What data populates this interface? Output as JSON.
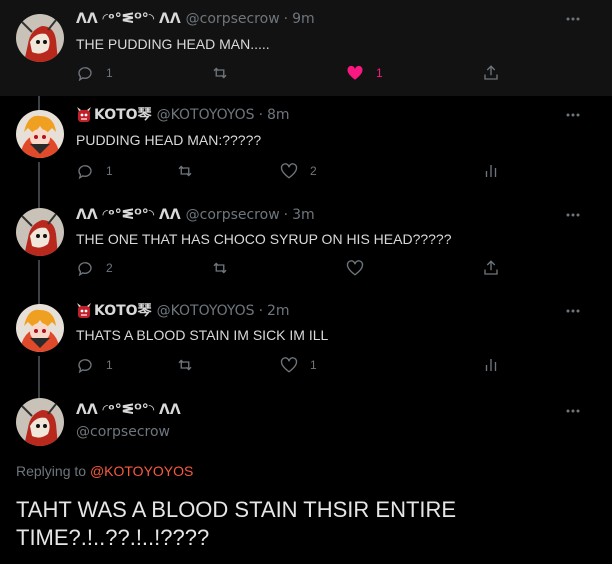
{
  "tweets": [
    {
      "display_name": "ᐱᐱ ◜ᵒ°ᓬᴼ°◝ ᐱᐱ",
      "handle": "@corpsecrow",
      "dot": "·",
      "time": "9m",
      "text": "THE PUDDING HEAD MAN.....",
      "reply_count": "1",
      "retweet_count": "",
      "like_count": "1",
      "liked": true
    },
    {
      "display_name": "KOTO琴",
      "handle": "@KOTOYOYOS",
      "dot": "·",
      "time": "8m",
      "text": "PUDDING HEAD MAN:?????",
      "reply_count": "1",
      "retweet_count": "",
      "like_count": "2",
      "liked": false
    },
    {
      "display_name": "ᐱᐱ ◜ᵒ°ᓬᴼ°◝ ᐱᐱ",
      "handle": "@corpsecrow",
      "dot": "·",
      "time": "3m",
      "text": "THE ONE THAT HAS CHOCO SYRUP ON HIS HEAD?????",
      "reply_count": "2",
      "retweet_count": "",
      "like_count": "",
      "liked": false
    },
    {
      "display_name": "KOTO琴",
      "handle": "@KOTOYOYOS",
      "dot": "·",
      "time": "2m",
      "text": "THATS A BLOOD STAIN IM SICK IM ILL",
      "reply_count": "1",
      "retweet_count": "",
      "like_count": "1",
      "liked": false
    }
  ],
  "main": {
    "display_name": "ᐱᐱ ◜ᵒ°ᓬᴼ°◝ ᐱᐱ",
    "handle": "@corpsecrow",
    "replying_prefix": "Replying to ",
    "replying_to": "@KOTOYOYOS",
    "text": "TAHT WAS A BLOOD STAIN THSIR ENTIRE TIME?.!..??.!..!????"
  },
  "icons": {
    "reply": "reply-icon",
    "retweet": "retweet-icon",
    "like": "heart-icon",
    "share": "share-icon",
    "analytics": "analytics-icon",
    "more": "more-icon",
    "ogre": "ogre-emoji-icon"
  },
  "colors": {
    "background": "#000000",
    "highlight_row": "#121212",
    "muted": "#6e767d",
    "accent": "#f75a40",
    "like": "#f91880",
    "thread_line": "#3d4247"
  }
}
